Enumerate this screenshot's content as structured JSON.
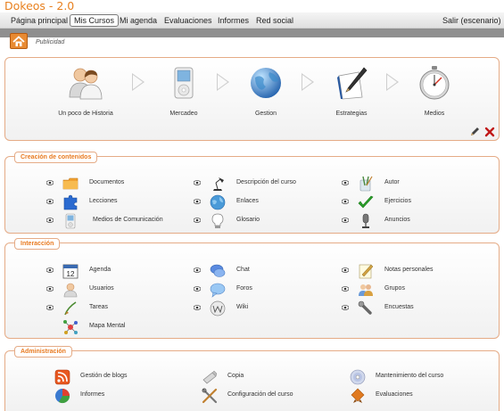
{
  "app": {
    "title": "Dokeos - 2.0"
  },
  "nav": {
    "items": [
      {
        "label": "Página principal"
      },
      {
        "label": "Mis Cursos"
      },
      {
        "label": "Mi agenda"
      },
      {
        "label": "Evaluaciones"
      },
      {
        "label": "Informes"
      },
      {
        "label": "Red social"
      }
    ],
    "logout": "Salir (escenario)"
  },
  "breadcrumb": {
    "current": "Publicidad"
  },
  "steps": [
    {
      "label": "Un poco de Historia",
      "icon": "users-icon"
    },
    {
      "label": "Mercadeo",
      "icon": "ipod-icon"
    },
    {
      "label": "Gestion",
      "icon": "globe-icon"
    },
    {
      "label": "Estrategias",
      "icon": "pen-paper-icon"
    },
    {
      "label": "Medios",
      "icon": "stopwatch-icon"
    }
  ],
  "content_creation": {
    "title": "Creación de contenidos",
    "tools": [
      {
        "label": "Documentos",
        "icon": "folder-icon"
      },
      {
        "label": "Descripción del curso",
        "icon": "lamp-icon"
      },
      {
        "label": "Autor",
        "icon": "author-icon"
      },
      {
        "label": "Lecciones",
        "icon": "puzzle-icon"
      },
      {
        "label": "Enlaces",
        "icon": "link-globe-icon"
      },
      {
        "label": "Ejercicios",
        "icon": "checkmark-icon"
      },
      {
        "label": "Medios de Comunicación",
        "icon": "ipod-icon"
      },
      {
        "label": "Glosario",
        "icon": "lightbulb-icon"
      },
      {
        "label": "Anuncios",
        "icon": "microphone-icon"
      }
    ]
  },
  "interaction": {
    "title": "Interacción",
    "tools": [
      {
        "label": "Agenda",
        "icon": "calendar-icon"
      },
      {
        "label": "Chat",
        "icon": "chat-icon"
      },
      {
        "label": "Notas personales",
        "icon": "notes-icon"
      },
      {
        "label": "Usuarios",
        "icon": "user-icon"
      },
      {
        "label": "Foros",
        "icon": "forum-icon"
      },
      {
        "label": "Grupos",
        "icon": "group-icon"
      },
      {
        "label": "Tareas",
        "icon": "tasks-icon"
      },
      {
        "label": "Wiki",
        "icon": "wiki-icon"
      },
      {
        "label": "Encuestas",
        "icon": "survey-icon"
      },
      {
        "label": "Mapa Mental",
        "icon": "mindmap-icon"
      }
    ]
  },
  "administration": {
    "title": "Administración",
    "tools": [
      {
        "label": "Gestión de blogs",
        "icon": "blog-icon"
      },
      {
        "label": "Copia",
        "icon": "usb-icon"
      },
      {
        "label": "Mantenimiento del curso",
        "icon": "cd-icon"
      },
      {
        "label": "Informes",
        "icon": "pie-chart-icon"
      },
      {
        "label": "Configuración del curso",
        "icon": "tools-icon"
      },
      {
        "label": "Evaluaciones",
        "icon": "award-icon"
      }
    ]
  },
  "colors": {
    "accent": "#e87a20",
    "panel_border": "#e5ab86",
    "subbar": "#8f8f8f"
  }
}
